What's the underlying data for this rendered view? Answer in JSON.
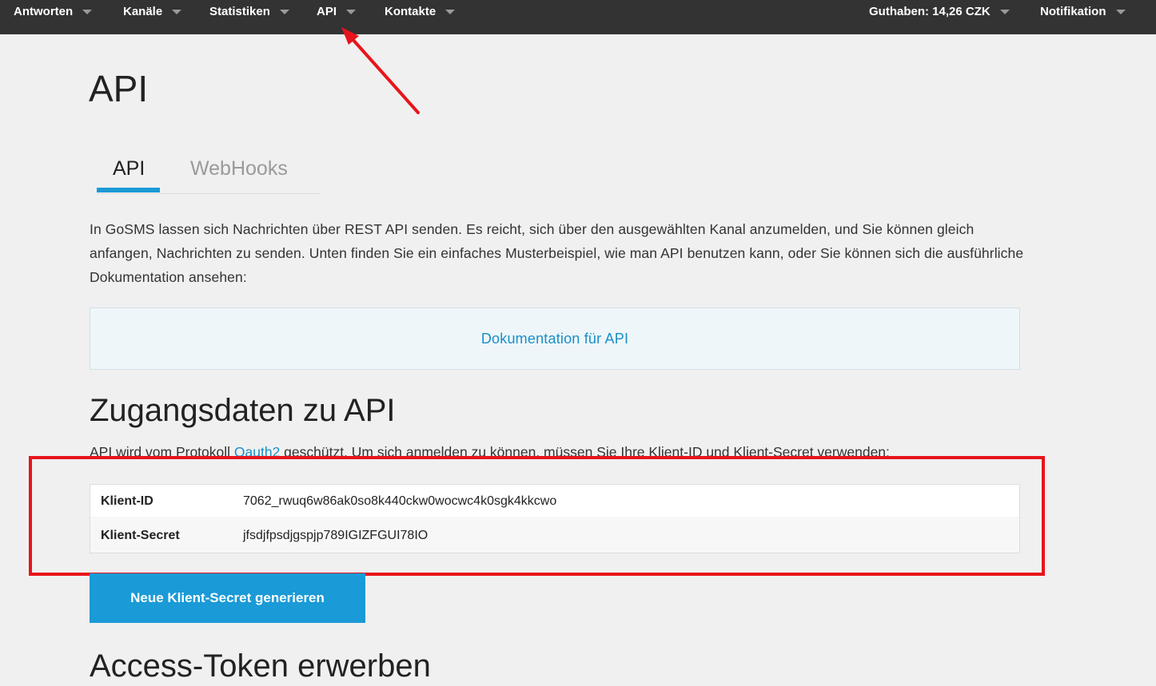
{
  "topnav": {
    "items": [
      {
        "label": "Antworten"
      },
      {
        "label": "Kanäle"
      },
      {
        "label": "Statistiken"
      },
      {
        "label": "API"
      },
      {
        "label": "Kontakte"
      }
    ],
    "balance_label": "Guthaben: 14,26 CZK",
    "notification_label": "Notifikation"
  },
  "main": {
    "title": "API",
    "tabs": [
      {
        "label": "API",
        "active": true
      },
      {
        "label": "WebHooks",
        "active": false
      }
    ],
    "intro": "In GoSMS lassen sich Nachrichten über REST API senden. Es reicht, sich über den ausgewählten Kanal anzumelden, und Sie können gleich anfangen, Nachrichten zu senden. Unten finden Sie ein einfaches Musterbeispiel, wie man API benutzen kann, oder Sie können sich die ausführliche Dokumentation ansehen:",
    "doc_link": "Dokumentation für API",
    "credentials": {
      "title": "Zugangsdaten zu API",
      "desc_before": "API wird vom Protokoll ",
      "desc_link": "Oauth2",
      "desc_after": " geschützt. Um sich anmelden zu können, müssen Sie Ihre Klient-ID und Klient-Secret verwenden:",
      "rows": [
        {
          "label": "Klient-ID",
          "value": "7062_rwuq6w86ak0so8k440ckw0wocwc4k0sgk4kkcwo"
        },
        {
          "label": "Klient-Secret",
          "value": "jfsdjfpsdjgspjp789IGIZFGUI78IO"
        }
      ],
      "generate_button": "Neue Klient-Secret generieren"
    },
    "access_token_title": "Access-Token erwerben"
  },
  "annotations": {
    "arrow_color": "#e8141b",
    "box_color": "#e8141b"
  },
  "colors": {
    "nav_bg": "#333333",
    "accent": "#1a9ad7",
    "link": "#1a8fc7"
  }
}
